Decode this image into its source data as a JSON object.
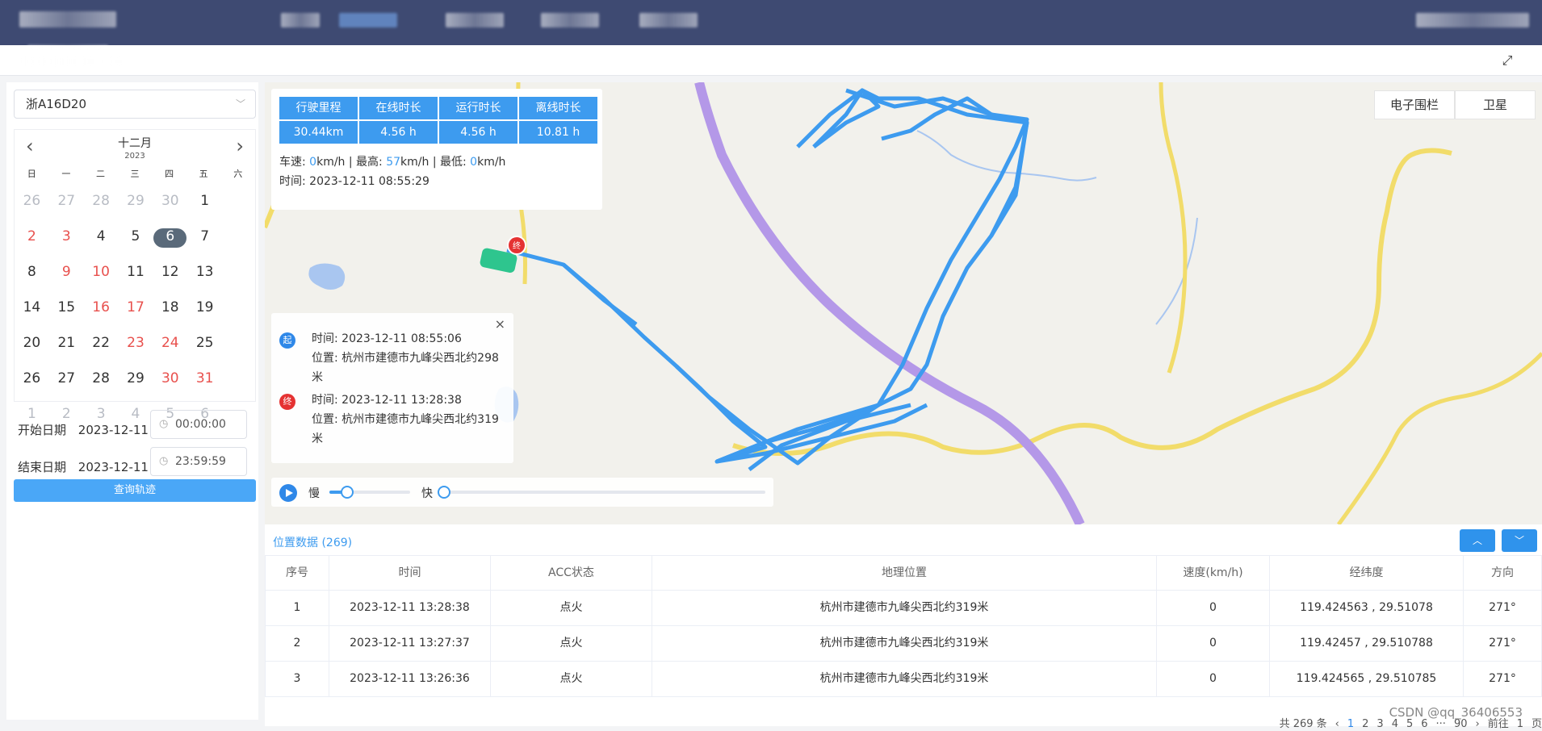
{
  "vehicle_select": {
    "value": "浙A16D20"
  },
  "calendar": {
    "month": "十二月",
    "year": "2023",
    "weekdays": [
      "日",
      "一",
      "二",
      "三",
      "四",
      "五",
      "六"
    ],
    "days": [
      "26",
      "27",
      "28",
      "29",
      "30",
      "1",
      "2",
      "3",
      "4",
      "5",
      "6",
      "7",
      "8",
      "9",
      "10",
      "11",
      "12",
      "13",
      "14",
      "15",
      "16",
      "17",
      "18",
      "19",
      "20",
      "21",
      "22",
      "23",
      "24",
      "25",
      "26",
      "27",
      "28",
      "29",
      "30",
      "31",
      "1",
      "2",
      "3",
      "4",
      "5",
      "6"
    ],
    "selected_day": "6"
  },
  "filters": {
    "start_label": "开始日期",
    "start_date": "2023-12-11",
    "start_time": "00:00:00",
    "end_label": "结束日期",
    "end_date": "2023-12-11",
    "end_time": "23:59:59",
    "query_label": "查询轨迹"
  },
  "stats": {
    "headers": [
      "行驶里程",
      "在线时长",
      "运行时长",
      "离线时长"
    ],
    "values": [
      "30.44km",
      "4.56 h",
      "4.56 h",
      "10.81 h"
    ],
    "speed_label": "车速: ",
    "speed": "0",
    "max_label": "km/h | 最高: ",
    "max": "57",
    "min_label": "km/h | 最低: ",
    "min": "0",
    "unit": "km/h",
    "time_line": "时间: 2023-12-11 08:55:29"
  },
  "info_popup": {
    "start_pin": "起",
    "start_time": "时间: 2023-12-11 08:55:06",
    "start_location": "位置: 杭州市建德市九峰尖西北约298米",
    "end_pin": "终",
    "end_time": "时间: 2023-12-11 13:28:38",
    "end_location": "位置: 杭州市建德市九峰尖西北约319米"
  },
  "playback": {
    "slow_label": "慢",
    "fast_label": "快",
    "speed_level": 0.22,
    "progress": 0.0
  },
  "map_layers": [
    "电子围栏",
    "卫星"
  ],
  "table": {
    "title": "位置数据 (269)",
    "headers": [
      "序号",
      "时间",
      "ACC状态",
      "地理位置",
      "速度(km/h)",
      "经纬度",
      "方向"
    ],
    "rows": [
      [
        "1",
        "2023-12-11 13:28:38",
        "点火",
        "杭州市建德市九峰尖西北约319米",
        "0",
        "119.424563 , 29.51078",
        "271°"
      ],
      [
        "2",
        "2023-12-11 13:27:37",
        "点火",
        "杭州市建德市九峰尖西北约319米",
        "0",
        "119.42457 , 29.510788",
        "271°"
      ],
      [
        "3",
        "2023-12-11 13:26:36",
        "点火",
        "杭州市建德市九峰尖西北约319米",
        "0",
        "119.424565 , 29.510785",
        "271°"
      ]
    ]
  },
  "pager": {
    "total": "共 269 条",
    "pages": [
      "1",
      "2",
      "3",
      "4",
      "5",
      "6",
      "···",
      "90"
    ],
    "goto_label": "前往",
    "goto_value": "1",
    "page_unit": "页"
  },
  "watermark": "CSDN @qq_36406553",
  "colors": {
    "topbar": "#3e4a72",
    "accent": "#3d9bef",
    "track": "#3d9bef",
    "weekend": "#e8504d"
  }
}
